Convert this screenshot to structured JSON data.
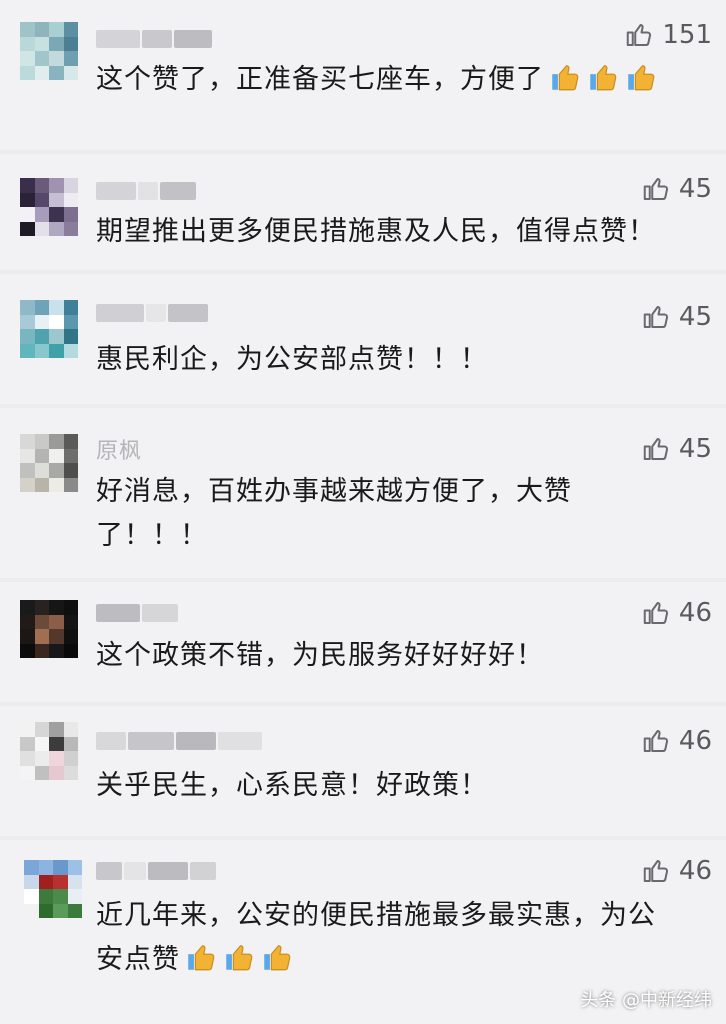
{
  "comments": [
    {
      "name": "",
      "likes": "151",
      "line1": "这个赞了，正准备买七座车，方便了",
      "line2": ""
    },
    {
      "name": "",
      "likes": "45",
      "line1": "期望推出更多便民措施惠及人民，值得点赞！",
      "line2": ""
    },
    {
      "name": "",
      "likes": "45",
      "line1": "惠民利企，为公安部点赞！！！",
      "line2": ""
    },
    {
      "name": "原枫",
      "likes": "45",
      "line1": "好消息，百姓办事越来越方便了，大赞",
      "line2": "了！！！"
    },
    {
      "name": "",
      "likes": "46",
      "line1": "这个政策不错，为民服务好好好好！",
      "line2": ""
    },
    {
      "name": "",
      "likes": "46",
      "line1": "关乎民生，心系民意！好政策！",
      "line2": ""
    },
    {
      "name": "",
      "likes": "46",
      "line1": "近几年来，公安的便民措施最多最实惠，为公",
      "line2": "安点赞"
    }
  ],
  "watermark": "头条 @中新经纬",
  "colors": {
    "thumbs_up_emoji": "#f2b233",
    "like_icon": "#6a6a6e"
  }
}
